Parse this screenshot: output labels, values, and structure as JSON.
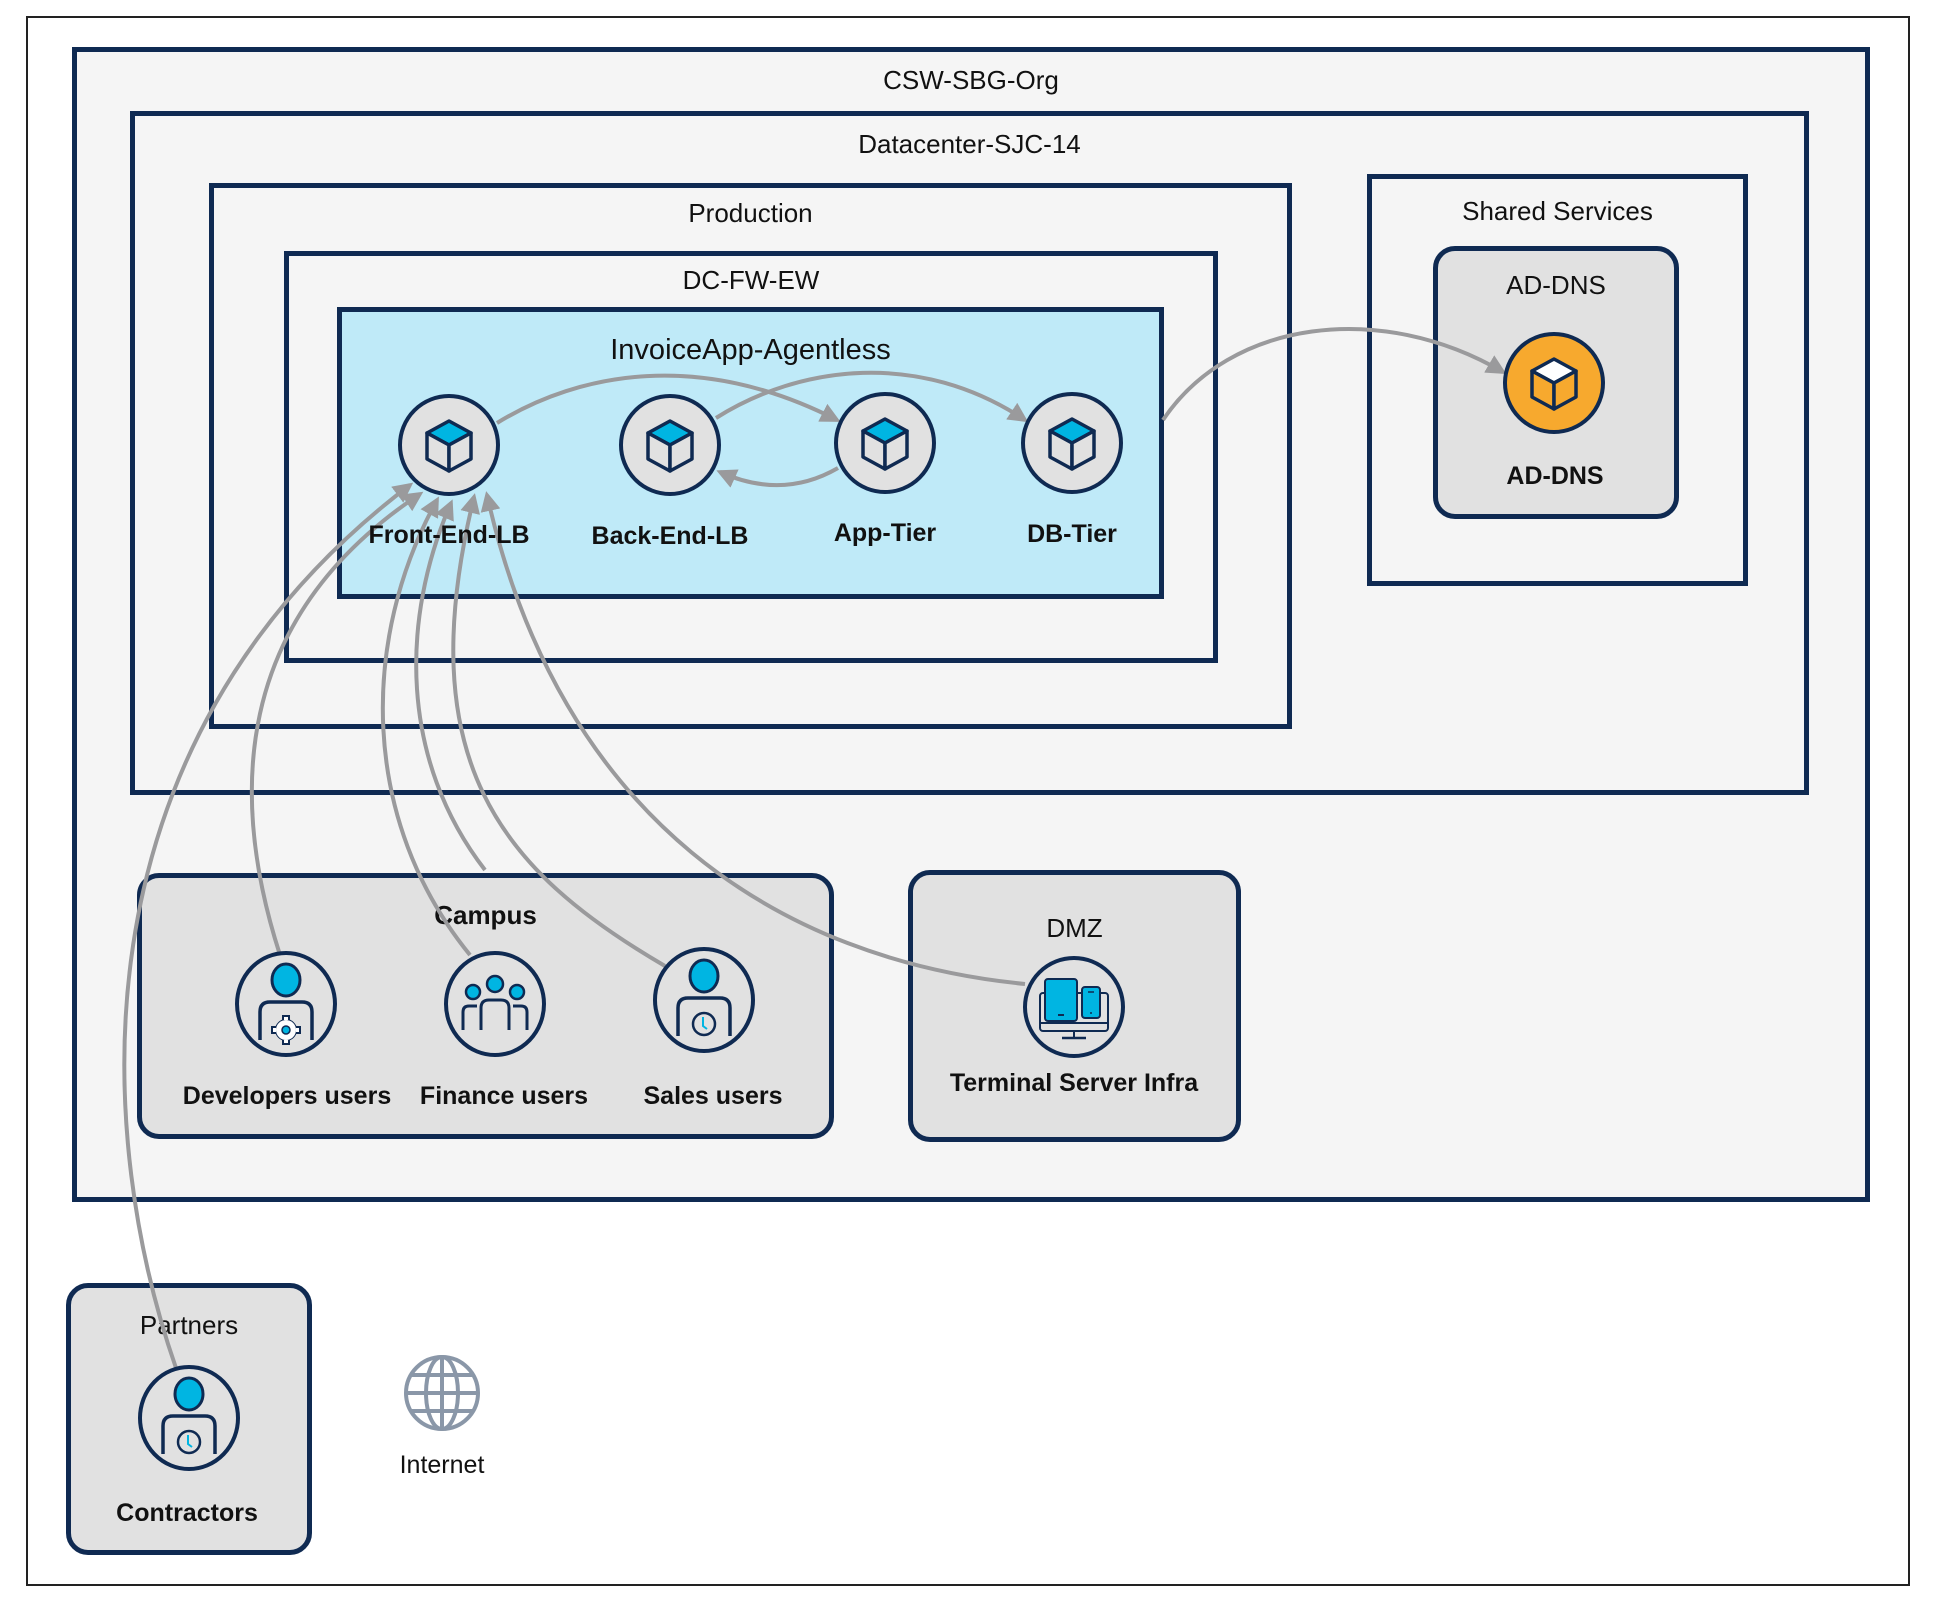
{
  "diagram": {
    "outer_frame": {},
    "zones": {
      "org": {
        "title": "CSW-SBG-Org"
      },
      "datacenter": {
        "title": "Datacenter-SJC-14"
      },
      "production": {
        "title": "Production"
      },
      "firewall": {
        "title": "DC-FW-EW"
      },
      "app": {
        "title": "InvoiceApp-Agentless"
      },
      "shared_services": {
        "title": "Shared Services"
      }
    },
    "groups": {
      "ad_dns": {
        "title": "AD-DNS"
      },
      "campus": {
        "title": "Campus"
      },
      "dmz": {
        "title": "DMZ"
      },
      "partners": {
        "title": "Partners"
      }
    },
    "nodes": {
      "front_end_lb": {
        "label": "Front-End-LB",
        "icon": "workload-cube-icon"
      },
      "back_end_lb": {
        "label": "Back-End-LB",
        "icon": "workload-cube-icon"
      },
      "app_tier": {
        "label": "App-Tier",
        "icon": "workload-cube-icon"
      },
      "db_tier": {
        "label": "DB-Tier",
        "icon": "workload-cube-icon"
      },
      "ad_dns": {
        "label": "AD-DNS",
        "icon": "workload-cube-icon"
      },
      "developers": {
        "label": "Developers users",
        "icon": "user-gear-icon"
      },
      "finance": {
        "label": "Finance users",
        "icon": "user-group-icon"
      },
      "sales": {
        "label": "Sales users",
        "icon": "user-clock-icon"
      },
      "terminal": {
        "label": "Terminal Server Infra",
        "icon": "devices-monitor-icon"
      },
      "contractors": {
        "label": "Contractors",
        "icon": "user-clock-icon"
      },
      "internet": {
        "label": "Internet",
        "icon": "globe-icon"
      }
    },
    "edges": [
      {
        "from": "front_end_lb",
        "to": "app_tier"
      },
      {
        "from": "back_end_lb",
        "to": "db_tier"
      },
      {
        "from": "app_tier",
        "to": "back_end_lb"
      },
      {
        "from": "db_tier",
        "to": "ad_dns"
      },
      {
        "from": "contractors",
        "to": "front_end_lb"
      },
      {
        "from": "developers",
        "to": "front_end_lb"
      },
      {
        "from": "finance",
        "to": "front_end_lb"
      },
      {
        "from": "campus",
        "to": "front_end_lb"
      },
      {
        "from": "sales",
        "to": "front_end_lb"
      },
      {
        "from": "terminal",
        "to": "front_end_lb"
      }
    ],
    "colors": {
      "border": "#0f2a52",
      "zone_fill": "#f5f5f5",
      "app_fill": "#bfeaf8",
      "group_fill": "#e1e1e1",
      "accent_cyan": "#00b5e2",
      "accent_orange": "#f7a92e",
      "edge": "#9a9a9c",
      "globe": "#8a97a8"
    }
  }
}
